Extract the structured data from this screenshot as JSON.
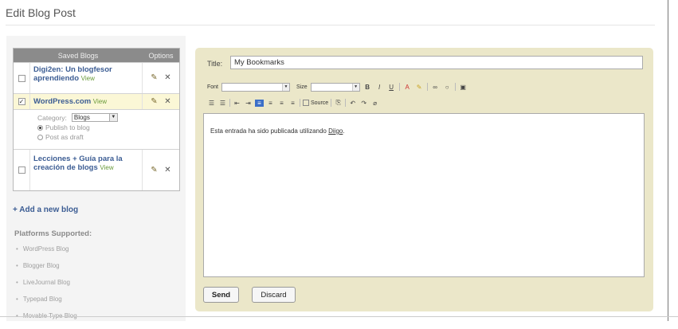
{
  "page": {
    "title": "Edit Blog Post"
  },
  "sidebar": {
    "table_headers": {
      "blogs": "Saved Blogs",
      "options": "Options"
    },
    "blogs": [
      {
        "name": "Digi2en: Un blogfesor aprendiendo",
        "view": "View",
        "checked": false
      },
      {
        "name": "WordPress.com",
        "view": "View",
        "checked": true
      },
      {
        "name": "Lecciones + Guía para la creación de blogs",
        "view": "View",
        "checked": false
      }
    ],
    "category": {
      "label": "Category:",
      "value": "Blogs",
      "publish_option": "Publish to blog",
      "draft_option": "Post as draft"
    },
    "add_blog_label": "+ Add a new blog",
    "platforms_title": "Platforms Supported:",
    "platforms": [
      "WordPress Blog",
      "Blogger Blog",
      "LiveJournal Blog",
      "Typepad Blog",
      "Movable Type Blog"
    ]
  },
  "editor": {
    "title_label": "Title:",
    "title_value": "My Bookmarks",
    "toolbar": {
      "font_label": "Font",
      "size_label": "Size",
      "source_label": "Source"
    },
    "body_text": "Esta entrada ha sido publicada utilizando",
    "body_link": "Diigo",
    "body_suffix": ".",
    "send_label": "Send",
    "discard_label": "Discard"
  },
  "colors": {
    "panel": "#ebe7c9",
    "link": "#3b5c93",
    "selected_row": "#fbf7d6"
  }
}
